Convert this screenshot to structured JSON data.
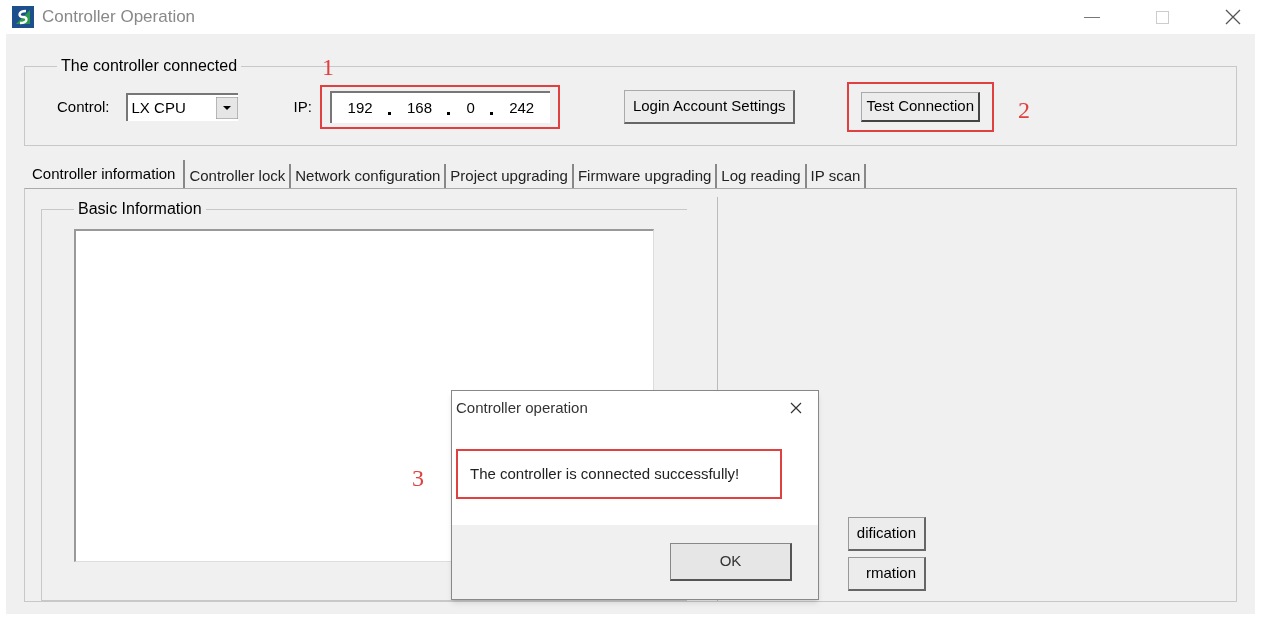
{
  "window": {
    "title": "Controller Operation"
  },
  "connection": {
    "group_title": "The controller connected",
    "control_label": "Control:",
    "control_value": "LX CPU",
    "ip_label": "IP:",
    "ip_octets": [
      "192",
      "168",
      "0",
      "242"
    ],
    "login_button": "Login Account Settings",
    "test_button": "Test Connection"
  },
  "tabs": [
    {
      "label": "Controller information",
      "selected": true
    },
    {
      "label": "Controller lock",
      "selected": false
    },
    {
      "label": "Network configuration",
      "selected": false
    },
    {
      "label": "Project upgrading",
      "selected": false
    },
    {
      "label": "Firmware upgrading",
      "selected": false
    },
    {
      "label": "Log reading",
      "selected": false
    },
    {
      "label": "IP scan",
      "selected": false
    }
  ],
  "panel": {
    "group_title": "Basic Information",
    "buttons": [
      "dification",
      "rmation"
    ]
  },
  "annotations": [
    "1",
    "2",
    "3"
  ],
  "dialog": {
    "title": "Controller operation",
    "message": "The controller is connected successfully!",
    "button": "OK"
  }
}
